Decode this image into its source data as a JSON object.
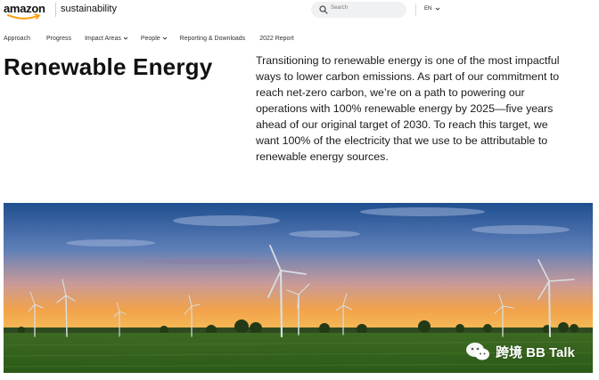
{
  "header": {
    "logo_text": "amazon",
    "brand_label": "sustainability",
    "search_placeholder": "Search",
    "language": "EN"
  },
  "nav": {
    "items": [
      {
        "label": "Approach"
      },
      {
        "label": "Progress"
      },
      {
        "label": "Impact Areas"
      },
      {
        "label": "People"
      },
      {
        "label": "Reporting & Downloads"
      },
      {
        "label": "2022 Report"
      }
    ]
  },
  "main": {
    "title": "Renewable Energy",
    "body_lines": [
      "Transitioning to renewable energy is one of the most impactful",
      "ways to lower carbon emissions. As part of our commitment to",
      "reach net-zero carbon, we’re on a path to powering our",
      "operations with 100% renewable energy by 2025—five years",
      "ahead of our original target of 2030. To reach this target, we",
      "want 100% of the electricity that we use to be attributable to",
      "renewable energy sources."
    ]
  },
  "watermark": {
    "text": "跨境 BB Talk",
    "icon": "wechat-icon"
  },
  "colors": {
    "amazon_orange": "#ff9900",
    "search_bg": "#f0f1f2"
  }
}
